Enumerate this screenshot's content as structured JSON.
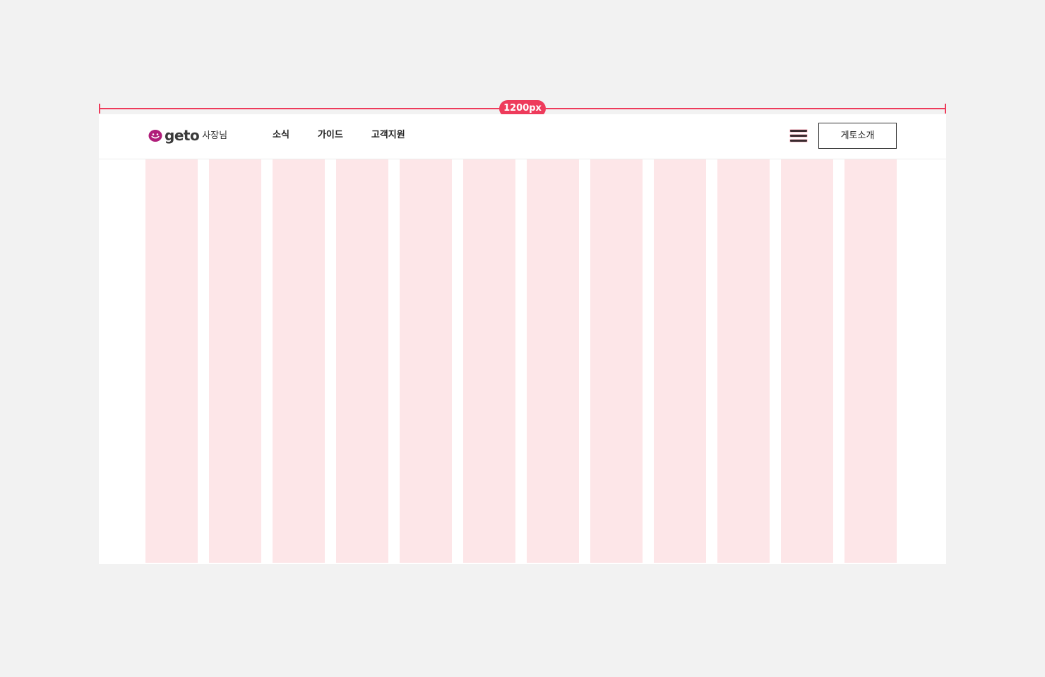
{
  "measure": {
    "label": "1200px",
    "color": "#ee3b5b"
  },
  "header": {
    "logo": {
      "icon": "geto-smile-icon",
      "word": "geto",
      "sub": "사장님",
      "brand_color": "#b01e7a"
    },
    "nav": [
      {
        "label": "소식"
      },
      {
        "label": "가이드"
      },
      {
        "label": "고객지원"
      }
    ],
    "menu_icon": "hamburger-menu-icon",
    "intro_button": "게토소개"
  },
  "grid": {
    "columns": 12,
    "column_color": "#fde6e8"
  }
}
